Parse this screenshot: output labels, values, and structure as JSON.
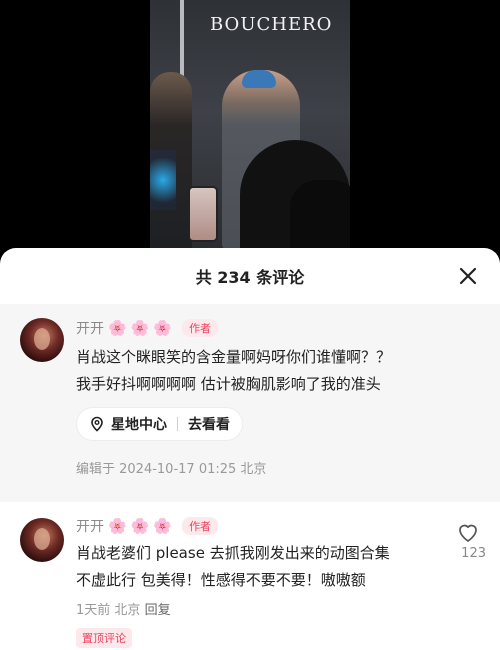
{
  "photo": {
    "brand_text": "BOUCHERO"
  },
  "sheet": {
    "title": "共 234 条评论",
    "close_icon": "close-icon"
  },
  "author_comment": {
    "user_name": "开开",
    "flowers": [
      "🌸",
      "🌸",
      "🌸"
    ],
    "badge": "作者",
    "lines": [
      "肖战这个眯眼笑的含金量啊妈呀你们谁懂啊？？",
      "我手好抖啊啊啊啊  估计被胸肌影响了我的准头"
    ],
    "location_chip": {
      "icon": "location-pin-icon",
      "label": "星地中心",
      "action": "去看看"
    },
    "meta": "编辑于  2024-10-17 01:25 北京"
  },
  "comment2": {
    "user_name": "开开",
    "flowers": [
      "🌸",
      "🌸",
      "🌸"
    ],
    "badge": "作者",
    "lines": [
      "肖战老婆们 please 去抓我刚发出来的动图合集",
      "不虚此行 包美得！性感得不要不要！嗷嗷额"
    ],
    "meta_time": "1天前",
    "meta_location": "北京",
    "reply": "回复",
    "like_icon": "heart-icon",
    "like_count": "123",
    "pinned_tag": "置顶评论"
  }
}
